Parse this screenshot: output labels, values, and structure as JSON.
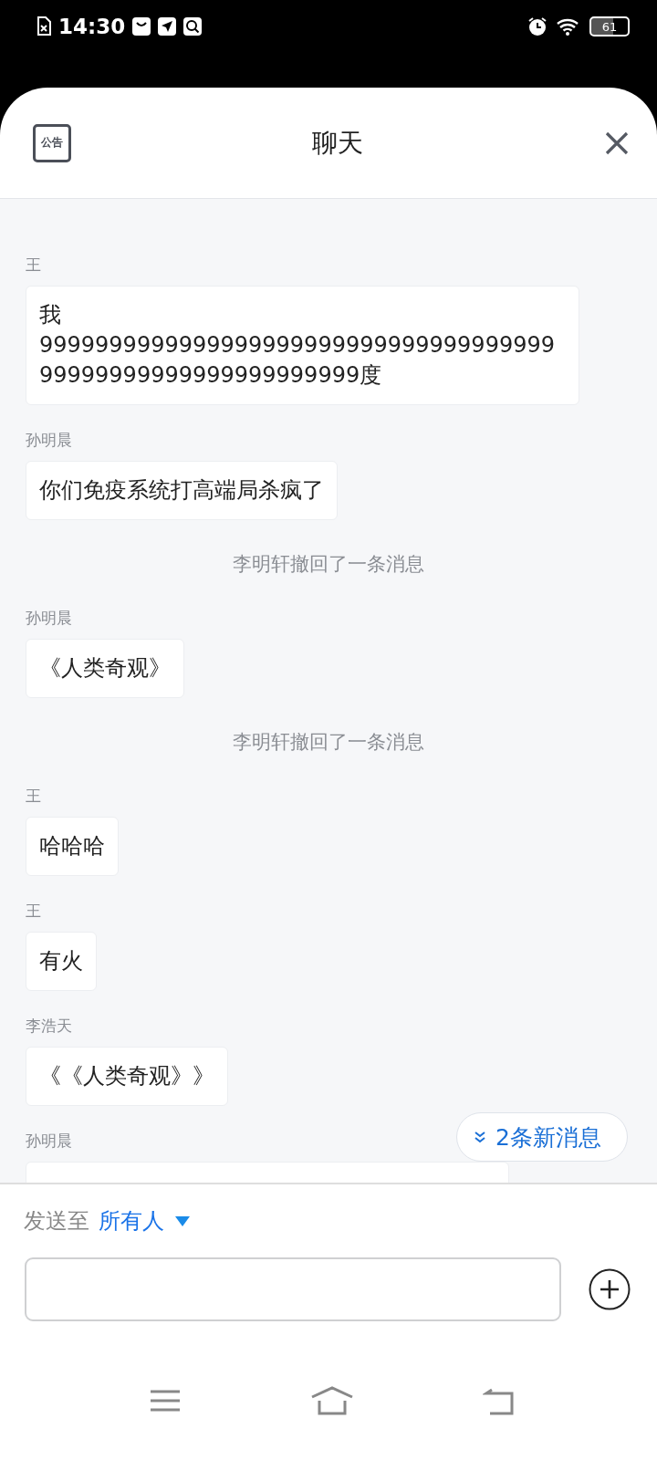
{
  "status_bar": {
    "time": "14:30",
    "battery": "61"
  },
  "header": {
    "notice_label": "公告",
    "title": "聊天"
  },
  "messages": [
    {
      "kind": "message",
      "sender": "王",
      "text": "我999999999999999999999999999999999999999999999999999999999999度"
    },
    {
      "kind": "message",
      "sender": "孙明晨",
      "text": "你们免疫系统打高端局杀疯了"
    },
    {
      "kind": "recall",
      "text": "李明轩撤回了一条消息"
    },
    {
      "kind": "message",
      "sender": "孙明晨",
      "text": "《人类奇观》"
    },
    {
      "kind": "recall",
      "text": "李明轩撤回了一条消息"
    },
    {
      "kind": "message",
      "sender": "王",
      "text": "哈哈哈"
    },
    {
      "kind": "message",
      "sender": "王",
      "text": "有火"
    },
    {
      "kind": "message",
      "sender": "李浩天",
      "text": "《《人类奇观》》"
    },
    {
      "kind": "message",
      "sender": "孙明晨"
    }
  ],
  "new_messages": {
    "label": "2条新消息"
  },
  "composer": {
    "send_to_label": "发送至",
    "recipient": "所有人"
  }
}
